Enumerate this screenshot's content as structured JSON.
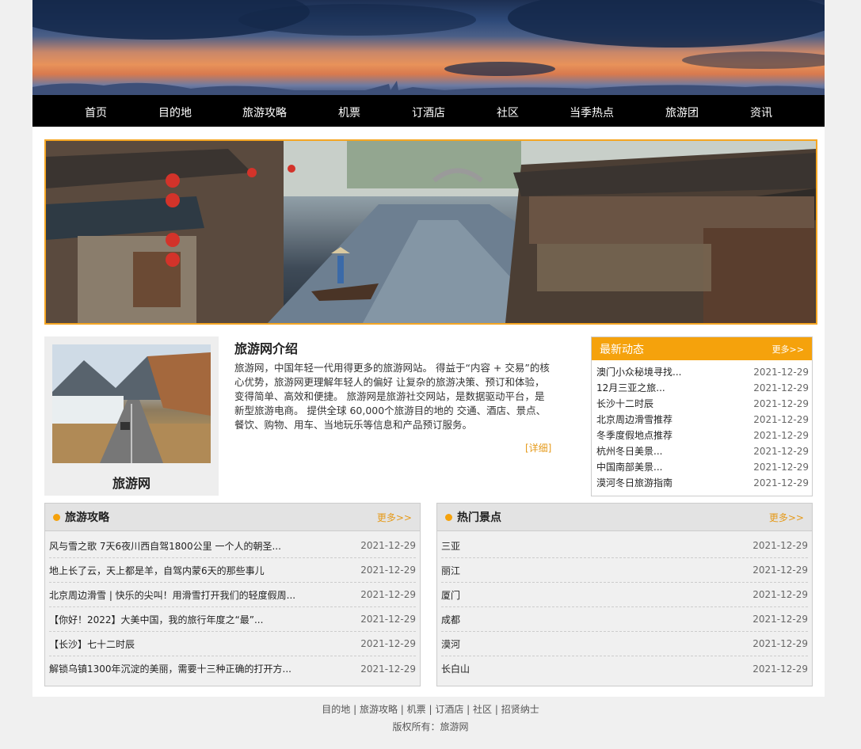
{
  "nav": [
    "首页",
    "目的地",
    "旅游攻略",
    "机票",
    "订酒店",
    "社区",
    "当季热点",
    "旅游团",
    "资讯"
  ],
  "about": {
    "name": "旅游网",
    "title": "旅游网介绍",
    "text": "旅游网，中国年轻一代用得更多的旅游网站。 得益于“内容 + 交易”的核心优势，旅游网更理解年轻人的偏好 让复杂的旅游决策、预订和体验，变得简单、高效和便捷。 旅游网是旅游社交网站，是数据驱动平台，是新型旅游电商。 提供全球 60,000个旅游目的地的 交通、酒店、景点、餐饮、购物、用车、当地玩乐等信息和产品预订服务。",
    "more": "[详细]"
  },
  "news": {
    "title": "最新动态",
    "more": "更多>>",
    "items": [
      {
        "title": "澳门小众秘境寻找...",
        "date": "2021-12-29"
      },
      {
        "title": "12月三亚之旅...",
        "date": "2021-12-29"
      },
      {
        "title": "长沙十二时辰",
        "date": "2021-12-29"
      },
      {
        "title": "北京周边滑雪推荐",
        "date": "2021-12-29"
      },
      {
        "title": "冬季度假地点推荐",
        "date": "2021-12-29"
      },
      {
        "title": "杭州冬日美景...",
        "date": "2021-12-29"
      },
      {
        "title": "中国南部美景...",
        "date": "2021-12-29"
      },
      {
        "title": "漠河冬日旅游指南",
        "date": "2021-12-29"
      }
    ]
  },
  "guides": {
    "title": "旅游攻略",
    "more": "更多>>",
    "items": [
      {
        "title": "风与雪之歌 7天6夜川西自驾1800公里 一个人的朝圣...",
        "date": "2021-12-29"
      },
      {
        "title": "地上长了云，天上都是羊，自驾内蒙6天的那些事儿",
        "date": "2021-12-29"
      },
      {
        "title": "北京周边滑雪 | 快乐的尖叫！用滑雪打开我们的轻度假周...",
        "date": "2021-12-29"
      },
      {
        "title": "【你好！2022】大美中国，我的旅行年度之“最”...",
        "date": "2021-12-29"
      },
      {
        "title": "【长沙】七十二时辰",
        "date": "2021-12-29"
      },
      {
        "title": "解锁乌镇1300年沉淀的美丽，需要十三种正确的打开方...",
        "date": "2021-12-29"
      }
    ]
  },
  "spots": {
    "title": "热门景点",
    "more": "更多>>",
    "items": [
      {
        "title": "三亚",
        "date": "2021-12-29"
      },
      {
        "title": "丽江",
        "date": "2021-12-29"
      },
      {
        "title": "厦门",
        "date": "2021-12-29"
      },
      {
        "title": "成都",
        "date": "2021-12-29"
      },
      {
        "title": "漠河",
        "date": "2021-12-29"
      },
      {
        "title": "长白山",
        "date": "2021-12-29"
      }
    ]
  },
  "footer": {
    "links": [
      "目的地",
      "旅游攻略",
      "机票",
      "订酒店",
      "社区",
      "招贤纳士"
    ],
    "copyright": "版权所有：旅游网"
  },
  "colors": {
    "accent": "#f5a20c",
    "nav_bg": "#000000"
  }
}
